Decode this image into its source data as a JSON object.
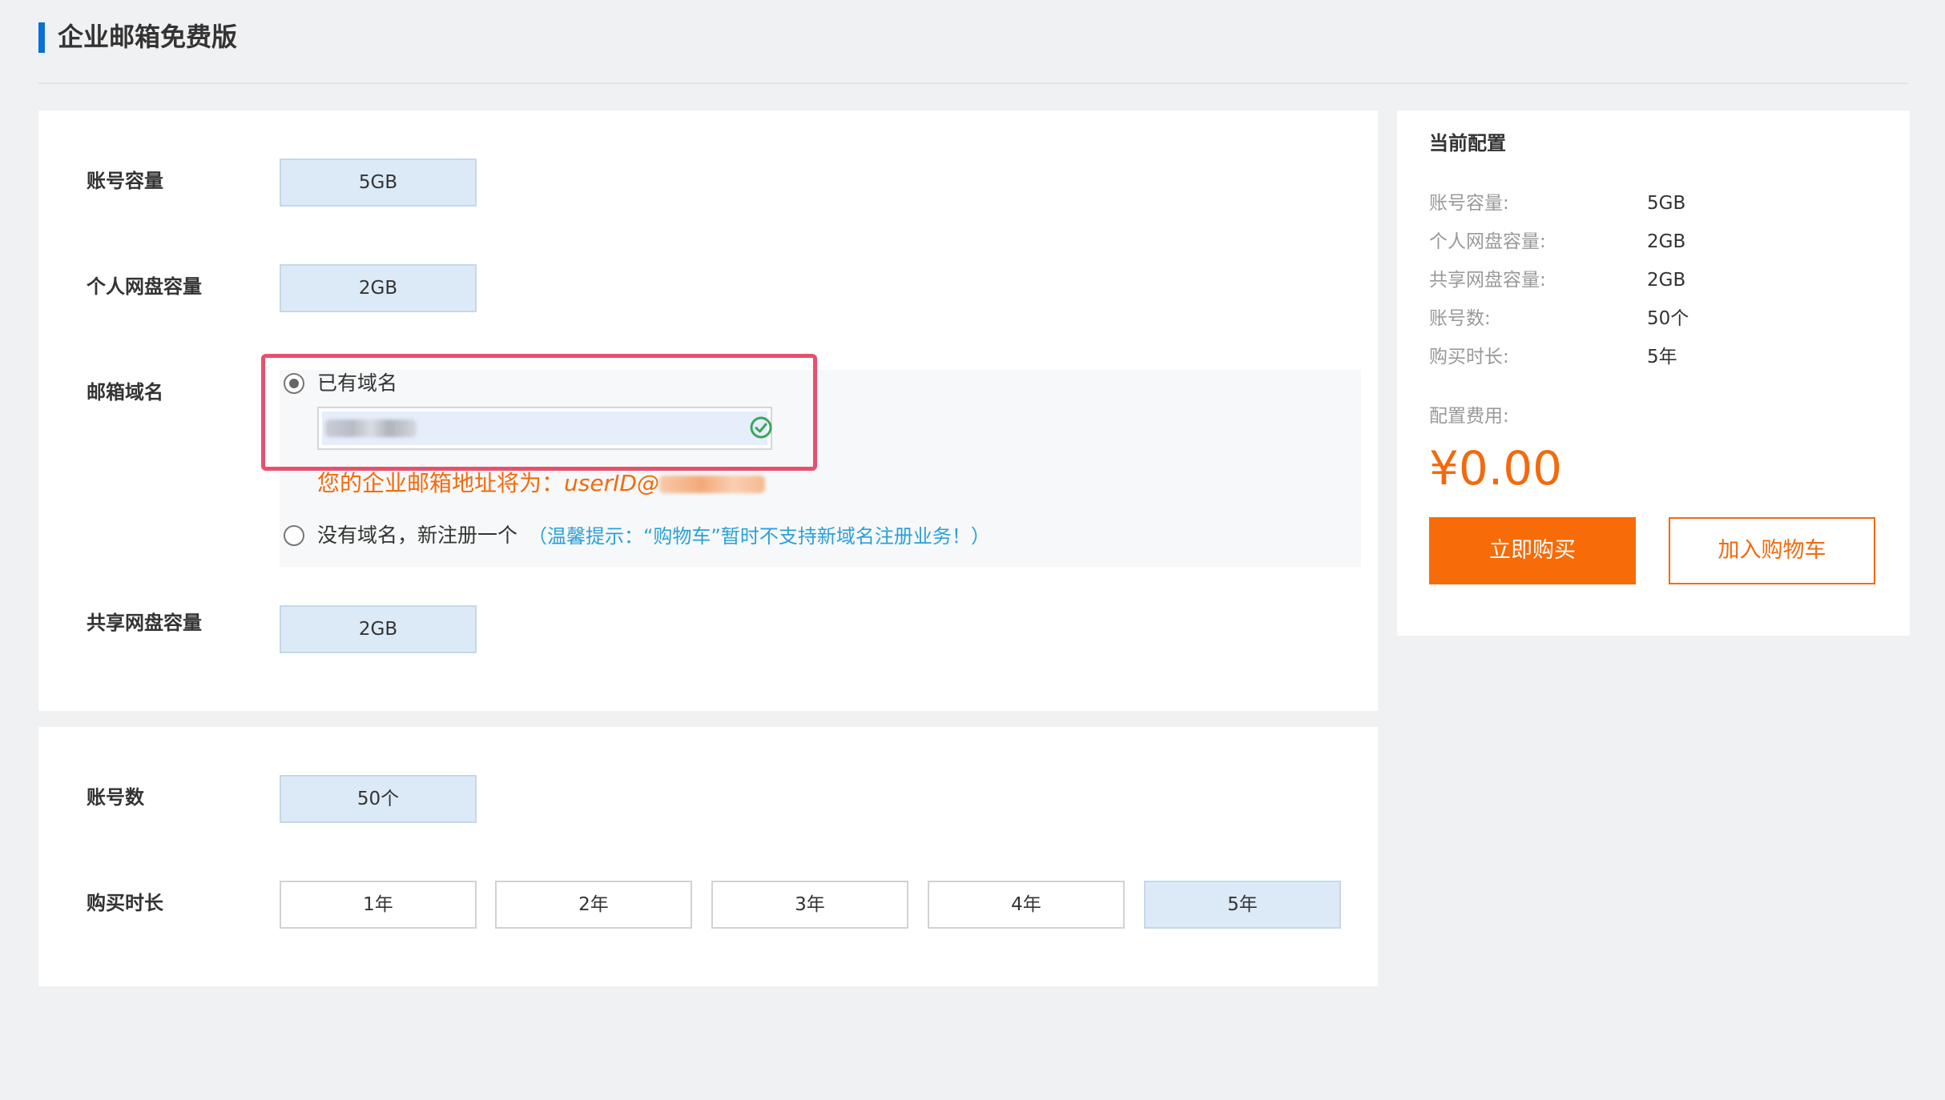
{
  "header": {
    "title": "企业邮箱免费版"
  },
  "config": {
    "account_capacity": {
      "label": "账号容量",
      "value": "5GB"
    },
    "personal_disk": {
      "label": "个人网盘容量",
      "value": "2GB"
    },
    "mail_domain": {
      "label": "邮箱域名",
      "option_existing": "已有域名",
      "option_new": "没有域名，新注册一个",
      "input_value": "",
      "email_hint_prefix": "您的企业邮箱地址将为：",
      "email_hint_user": "userID@",
      "tip": "（温馨提示：“购物车”暂时不支持新域名注册业务！）"
    },
    "shared_disk": {
      "label": "共享网盘容量",
      "value": "2GB"
    },
    "account_count": {
      "label": "账号数",
      "value": "50个"
    },
    "duration": {
      "label": "购买时长",
      "options": [
        "1年",
        "2年",
        "3年",
        "4年",
        "5年"
      ],
      "selected": "5年"
    }
  },
  "summary": {
    "title": "当前配置",
    "items": [
      {
        "key": "账号容量:",
        "value": "5GB"
      },
      {
        "key": "个人网盘容量:",
        "value": "2GB"
      },
      {
        "key": "共享网盘容量:",
        "value": "2GB"
      },
      {
        "key": "账号数:",
        "value": "50个"
      },
      {
        "key": "购买时长:",
        "value": "5年"
      }
    ],
    "fee_label": "配置费用:",
    "price": "¥0.00",
    "buy_label": "立即购买",
    "cart_label": "加入购物车"
  },
  "colors": {
    "accent": "#f76b08",
    "selected_bg": "#dceaf7",
    "highlight": "#e8506e",
    "link": "#2aa0d8"
  }
}
